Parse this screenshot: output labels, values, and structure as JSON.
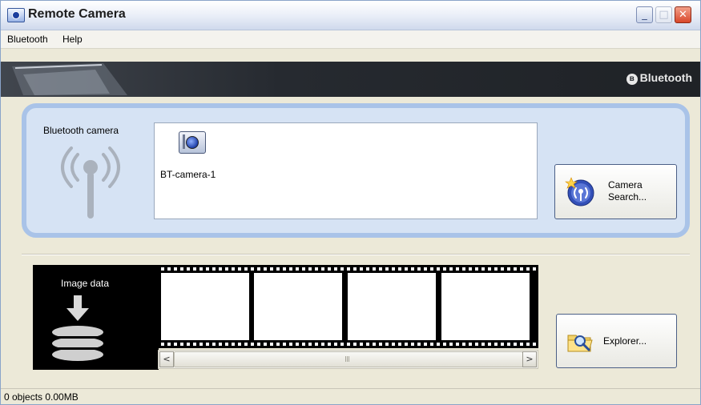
{
  "window": {
    "title": "Remote Camera",
    "controls": {
      "minimize": "_",
      "maximize": "□",
      "close": "✕"
    }
  },
  "menu": {
    "items": [
      "Bluetooth",
      "Help"
    ]
  },
  "banner": {
    "brand": "Bluetooth",
    "brand_symbol": "ʙ"
  },
  "camera_section": {
    "label": "Bluetooth camera",
    "icon": "antenna-icon",
    "devices": [
      {
        "name": "BT-camera-1",
        "icon": "camera-icon"
      }
    ],
    "search_button": {
      "line1": "Camera",
      "line2": "Search...",
      "icon": "camera-search-icon"
    }
  },
  "image_section": {
    "label": "Image data",
    "icon": "download-disk-icon",
    "frames": 4,
    "scroll_left": "<",
    "scroll_right": ">",
    "explorer_button": {
      "label": "Explorer...",
      "icon": "explorer-folder-icon"
    }
  },
  "status": {
    "text": "0 objects 0.00MB"
  },
  "colors": {
    "panel_border": "#a9c3e8",
    "panel_fill": "#d6e3f4",
    "banner": "#262a30",
    "close_button": "#d8472a"
  }
}
